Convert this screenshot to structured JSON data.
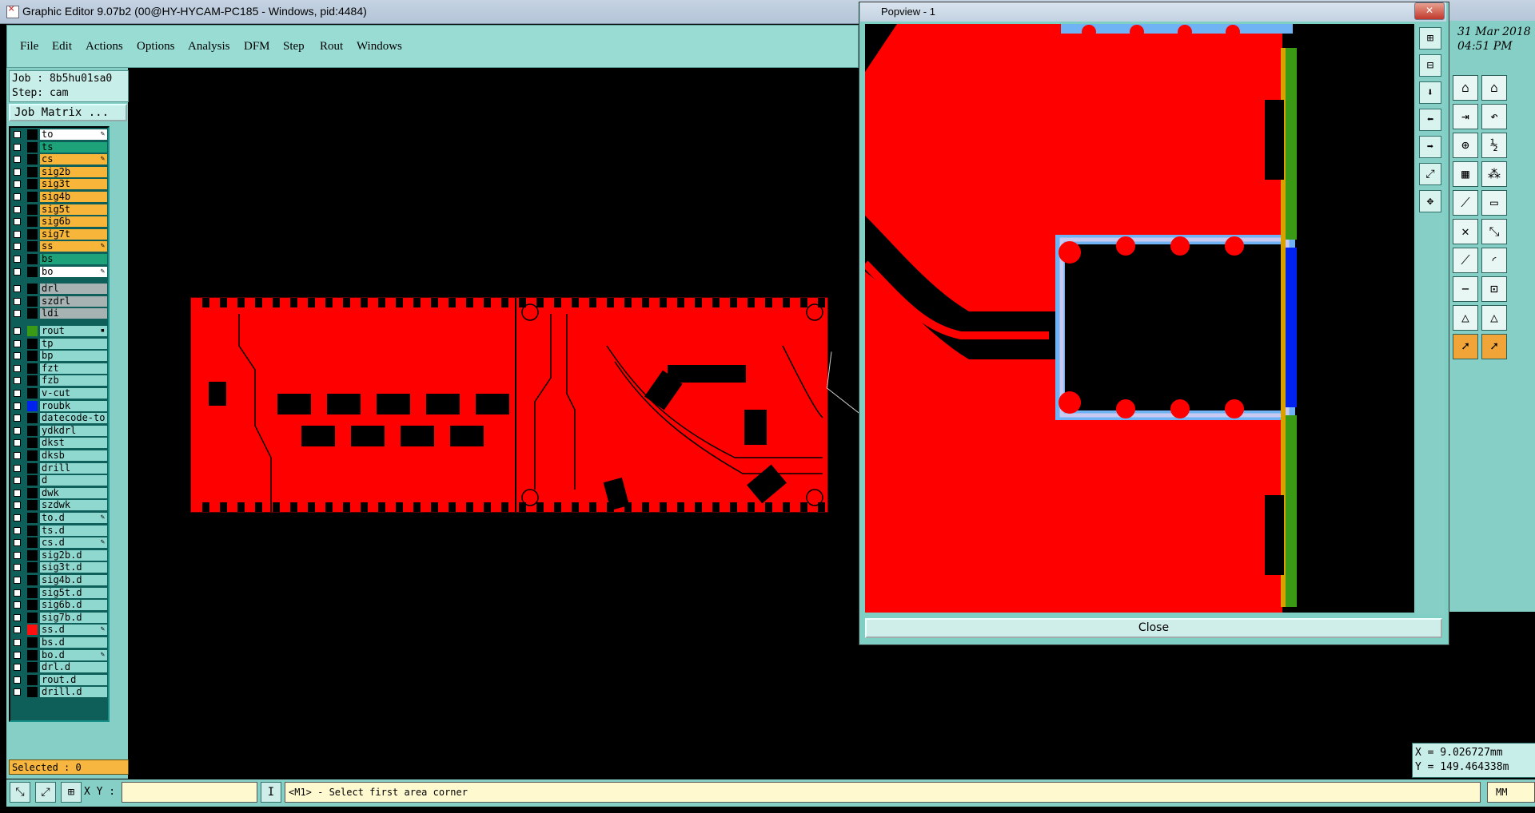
{
  "window": {
    "title": "Graphic Editor 9.07b2 (00@HY-HYCAM-PC185 - Windows, pid:4484)",
    "min_glyph": "–",
    "max_glyph": "□",
    "close_glyph": "✕"
  },
  "menu": [
    "File",
    "Edit",
    "Actions",
    "Options",
    "Analysis",
    "DFM",
    "Step",
    "Rout",
    "Windows"
  ],
  "job": {
    "job_line": "Job : 8b5hu01sa0",
    "step_line": "Step: cam",
    "matrix_label": "Job Matrix ..."
  },
  "layers": [
    {
      "name": "to",
      "color": "#ffffff",
      "swatch": "#000000",
      "flag": "✎"
    },
    {
      "name": "ts",
      "color": "#1ea27a",
      "swatch": "#000000",
      "flag": ""
    },
    {
      "name": "cs",
      "color": "#f7b63a",
      "swatch": "#000000",
      "flag": "✎"
    },
    {
      "name": "sig2b",
      "color": "#f7b63a",
      "swatch": "#000000",
      "flag": ""
    },
    {
      "name": "sig3t",
      "color": "#f7b63a",
      "swatch": "#000000",
      "flag": ""
    },
    {
      "name": "sig4b",
      "color": "#f7b63a",
      "swatch": "#000000",
      "flag": ""
    },
    {
      "name": "sig5t",
      "color": "#f7b63a",
      "swatch": "#000000",
      "flag": ""
    },
    {
      "name": "sig6b",
      "color": "#f7b63a",
      "swatch": "#000000",
      "flag": ""
    },
    {
      "name": "sig7t",
      "color": "#f7b63a",
      "swatch": "#000000",
      "flag": ""
    },
    {
      "name": "ss",
      "color": "#f7b63a",
      "swatch": "#000000",
      "flag": "✎"
    },
    {
      "name": "bs",
      "color": "#1ea27a",
      "swatch": "#000000",
      "flag": ""
    },
    {
      "name": "bo",
      "color": "#ffffff",
      "swatch": "#000000",
      "flag": "✎"
    },
    {
      "name": "drl",
      "color": "#a7b3b3",
      "swatch": "#000000",
      "flag": ""
    },
    {
      "name": "szdrl",
      "color": "#a7b3b3",
      "swatch": "#000000",
      "flag": ""
    },
    {
      "name": "ldi",
      "color": "#a7b3b3",
      "swatch": "#000000",
      "flag": ""
    },
    {
      "name": "rout",
      "color": "#8fd8cf",
      "swatch": "#3a9a16",
      "flag": "▪"
    },
    {
      "name": "tp",
      "color": "#8fd8cf",
      "swatch": "#000000",
      "flag": ""
    },
    {
      "name": "bp",
      "color": "#8fd8cf",
      "swatch": "#000000",
      "flag": ""
    },
    {
      "name": "fzt",
      "color": "#8fd8cf",
      "swatch": "#000000",
      "flag": ""
    },
    {
      "name": "fzb",
      "color": "#8fd8cf",
      "swatch": "#000000",
      "flag": ""
    },
    {
      "name": "v-cut",
      "color": "#8fd8cf",
      "swatch": "#000000",
      "flag": ""
    },
    {
      "name": "roubk",
      "color": "#8fd8cf",
      "swatch": "#0022ee",
      "flag": ""
    },
    {
      "name": "datecode-to",
      "color": "#8fd8cf",
      "swatch": "#000000",
      "flag": ""
    },
    {
      "name": "ydkdrl",
      "color": "#8fd8cf",
      "swatch": "#000000",
      "flag": ""
    },
    {
      "name": "dkst",
      "color": "#8fd8cf",
      "swatch": "#000000",
      "flag": ""
    },
    {
      "name": "dksb",
      "color": "#8fd8cf",
      "swatch": "#000000",
      "flag": ""
    },
    {
      "name": "drill",
      "color": "#8fd8cf",
      "swatch": "#000000",
      "flag": ""
    },
    {
      "name": "d",
      "color": "#8fd8cf",
      "swatch": "#000000",
      "flag": ""
    },
    {
      "name": "dwk",
      "color": "#8fd8cf",
      "swatch": "#000000",
      "flag": ""
    },
    {
      "name": "szdwk",
      "color": "#8fd8cf",
      "swatch": "#000000",
      "flag": ""
    },
    {
      "name": "to.d",
      "color": "#8fd8cf",
      "swatch": "#000000",
      "flag": "✎"
    },
    {
      "name": "ts.d",
      "color": "#8fd8cf",
      "swatch": "#000000",
      "flag": ""
    },
    {
      "name": "cs.d",
      "color": "#8fd8cf",
      "swatch": "#000000",
      "flag": "✎"
    },
    {
      "name": "sig2b.d",
      "color": "#8fd8cf",
      "swatch": "#000000",
      "flag": ""
    },
    {
      "name": "sig3t.d",
      "color": "#8fd8cf",
      "swatch": "#000000",
      "flag": ""
    },
    {
      "name": "sig4b.d",
      "color": "#8fd8cf",
      "swatch": "#000000",
      "flag": ""
    },
    {
      "name": "sig5t.d",
      "color": "#8fd8cf",
      "swatch": "#000000",
      "flag": ""
    },
    {
      "name": "sig6b.d",
      "color": "#8fd8cf",
      "swatch": "#000000",
      "flag": ""
    },
    {
      "name": "sig7b.d",
      "color": "#8fd8cf",
      "swatch": "#000000",
      "flag": ""
    },
    {
      "name": "ss.d",
      "color": "#8fd8cf",
      "swatch": "#ff1010",
      "flag": "✎"
    },
    {
      "name": "bs.d",
      "color": "#8fd8cf",
      "swatch": "#000000",
      "flag": ""
    },
    {
      "name": "bo.d",
      "color": "#8fd8cf",
      "swatch": "#000000",
      "flag": "✎"
    },
    {
      "name": "drl.d",
      "color": "#8fd8cf",
      "swatch": "#000000",
      "flag": ""
    },
    {
      "name": "rout.d",
      "color": "#8fd8cf",
      "swatch": "#000000",
      "flag": ""
    },
    {
      "name": "drill.d",
      "color": "#8fd8cf",
      "swatch": "#000000",
      "flag": ""
    }
  ],
  "selected_label": "Selected : 0",
  "popview": {
    "title": "Popview - 1",
    "close_label": "Close",
    "close_glyph": "✕"
  },
  "clock": {
    "date": "31 Mar 2018",
    "time": "04:51 PM"
  },
  "coords": {
    "x_line": "X = 9.026727mm",
    "y_line": "Y = 149.464338m"
  },
  "status": {
    "xy_label": "X Y :",
    "xy_value": "",
    "message": "<M1> - Select first area corner",
    "unit": "MM"
  },
  "colors": {
    "board": "#ff0000",
    "teal": "#86cfc6",
    "menu": "#98dcd4",
    "outline_blue": "#6fb3f5",
    "rout_green": "#3a9a16"
  },
  "icons": [
    "zoom-area-icon",
    "zoom-fit-icon",
    "grid-icon",
    "cursor-icon",
    "pan-icon",
    "measure-icon",
    "snap-icon",
    "arrow-icon"
  ]
}
